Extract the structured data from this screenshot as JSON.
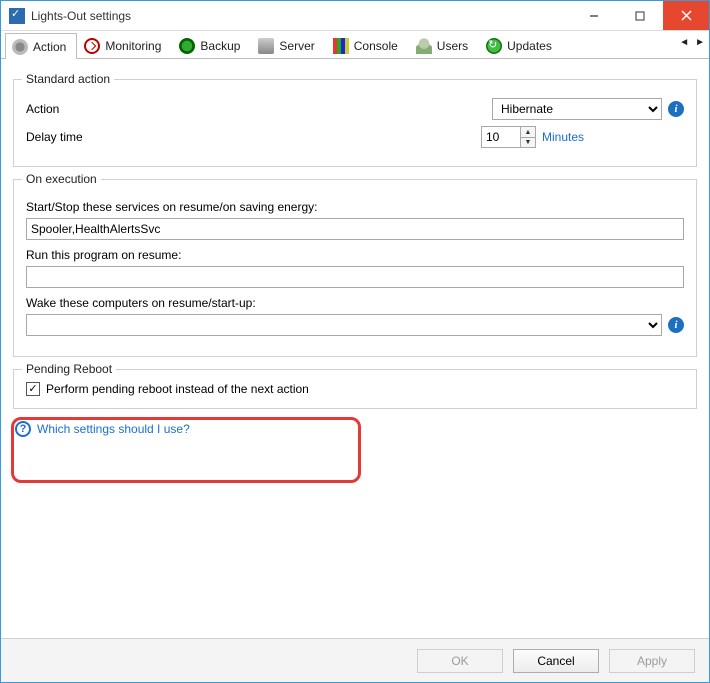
{
  "window": {
    "title": "Lights-Out settings"
  },
  "tabs": [
    {
      "label": "Action",
      "icon": "gear-icon",
      "active": true
    },
    {
      "label": "Monitoring",
      "icon": "monitor-icon",
      "active": false
    },
    {
      "label": "Backup",
      "icon": "backup-icon",
      "active": false
    },
    {
      "label": "Server",
      "icon": "server-icon",
      "active": false
    },
    {
      "label": "Console",
      "icon": "console-icon",
      "active": false
    },
    {
      "label": "Users",
      "icon": "users-icon",
      "active": false
    },
    {
      "label": "Updates",
      "icon": "updates-icon",
      "active": false
    }
  ],
  "standard_action": {
    "legend": "Standard action",
    "action_label": "Action",
    "action_value": "Hibernate",
    "delay_label": "Delay time",
    "delay_value": "10",
    "delay_unit": "Minutes"
  },
  "on_execution": {
    "legend": "On execution",
    "services_label": "Start/Stop these services on resume/on saving energy:",
    "services_value": "Spooler,HealthAlertsSvc",
    "program_label": "Run this program on resume:",
    "program_value": "",
    "wake_label": "Wake these computers on resume/start-up:",
    "wake_value": ""
  },
  "pending_reboot": {
    "legend": "Pending Reboot",
    "checkbox_label": "Perform pending reboot instead of the next action",
    "checkbox_checked": true
  },
  "help_link": "Which settings should I use?",
  "buttons": {
    "ok": "OK",
    "cancel": "Cancel",
    "apply": "Apply"
  }
}
